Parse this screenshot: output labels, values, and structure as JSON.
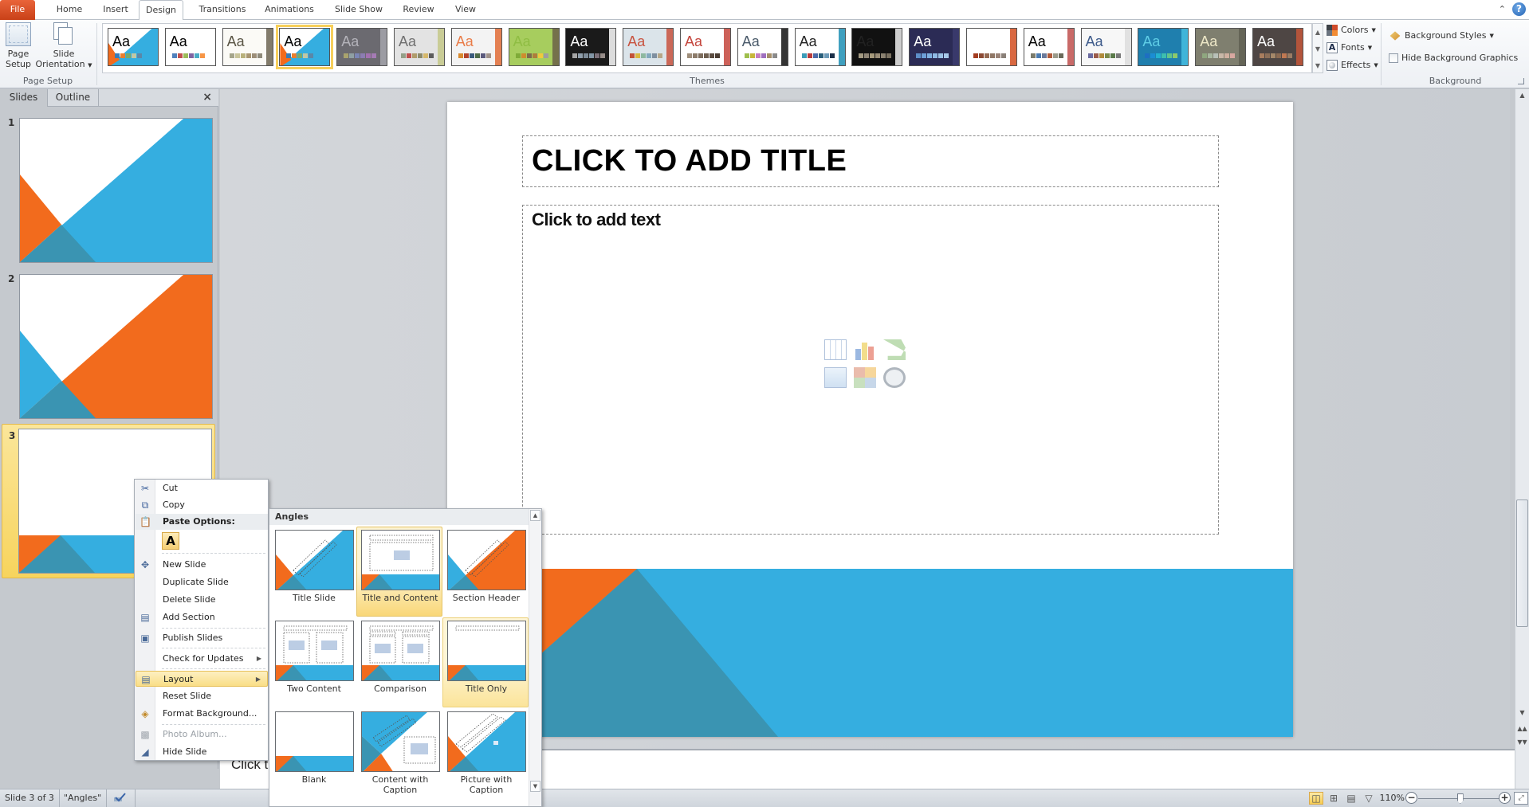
{
  "app": {
    "tabs": [
      {
        "label": "File"
      },
      {
        "label": "Home"
      },
      {
        "label": "Insert"
      },
      {
        "label": "Design"
      },
      {
        "label": "Transitions"
      },
      {
        "label": "Animations"
      },
      {
        "label": "Slide Show"
      },
      {
        "label": "Review"
      },
      {
        "label": "View"
      }
    ],
    "active_tab": "Design",
    "help_label": "?"
  },
  "ribbon": {
    "page_setup_group": {
      "label": "Page Setup",
      "page_setup_line1": "Page",
      "page_setup_line2": "Setup",
      "orientation_line1": "Slide",
      "orientation_line2": "Orientation"
    },
    "themes_group": {
      "label": "Themes",
      "selected_index": 3,
      "themes": [
        {
          "aa": "Aa",
          "bg": "#ffffff",
          "accent": "#35aee0",
          "text": "#000000",
          "swatches": [
            "#3b7bb5",
            "#e97e2e",
            "#7aa96d",
            "#c0c7a5",
            "#5a87a8"
          ]
        },
        {
          "aa": "Aa",
          "bg": "#ffffff",
          "accent": "#ffffff",
          "text": "#000000",
          "swatches": [
            "#4f81bd",
            "#c0504d",
            "#9bbb59",
            "#8064a2",
            "#4bacc6",
            "#f79646"
          ]
        },
        {
          "aa": "Aa",
          "bg": "#fbfaf6",
          "accent": "#6c6452",
          "text": "#5b5646",
          "swatches": [
            "#a5a58b",
            "#c9c59b",
            "#b8b07a",
            "#a89570",
            "#9c8e78",
            "#8f8a7b"
          ]
        },
        {
          "aa": "Aa",
          "bg": "#ffffff",
          "accent": "#35aee0",
          "text": "#000000",
          "swatches": [
            "#3b7bb5",
            "#e97e2e",
            "#7aa96d",
            "#c0c7a5",
            "#5a87a8"
          ]
        },
        {
          "aa": "Aa",
          "bg": "#6b6a70",
          "accent": "#a5a4ab",
          "text": "#b4b3ba",
          "swatches": [
            "#a9a36d",
            "#8fa0a3",
            "#7b86b5",
            "#8c7db2",
            "#a371b0",
            "#a57bb5"
          ]
        },
        {
          "aa": "Aa",
          "bg": "#e3e3e3",
          "accent": "#c4c888",
          "text": "#707070",
          "swatches": [
            "#94a088",
            "#c0504d",
            "#b09c6b",
            "#8c8a6a",
            "#d6b86b",
            "#5c5c5c"
          ]
        },
        {
          "aa": "Aa",
          "bg": "#f3f3f3",
          "accent": "#e06b35",
          "text": "#e97c48",
          "swatches": [
            "#d98a2e",
            "#b3432b",
            "#3a5a7c",
            "#4e6b48",
            "#5b5a7c",
            "#a0928a"
          ]
        },
        {
          "aa": "Aa",
          "bg": "#a7cd5e",
          "accent": "#6c6048",
          "text": "#8fbd43",
          "swatches": [
            "#7fab38",
            "#ce8d2d",
            "#7d6a4c",
            "#ae7d3b",
            "#f0c93d",
            "#9d9d9d"
          ]
        },
        {
          "aa": "Aa",
          "bg": "#1a1a1a",
          "accent": "#ffffff",
          "text": "#ffffff",
          "swatches": [
            "#a5a5a5",
            "#8f9eab",
            "#7d8b98",
            "#8296a6",
            "#7c7079",
            "#978d89"
          ]
        },
        {
          "aa": "Aa",
          "bg": "#dbe4ea",
          "accent": "#c8523e",
          "text": "#c8523e",
          "swatches": [
            "#c25238",
            "#d9b840",
            "#8db8a0",
            "#83a9be",
            "#7e8fa0",
            "#b6a789"
          ]
        },
        {
          "aa": "Aa",
          "bg": "#ffffff",
          "accent": "#c4453c",
          "text": "#c4453c",
          "swatches": [
            "#9f8e7b",
            "#8c7b6a",
            "#7d6d5d",
            "#6f5f50",
            "#5b4c40",
            "#4b3d33"
          ]
        },
        {
          "aa": "Aa",
          "bg": "#ffffff",
          "accent": "#111111",
          "text": "#4a5a6a",
          "swatches": [
            "#9fbf4d",
            "#c7b63a",
            "#c47fbf",
            "#9f6fbf",
            "#a68f6a",
            "#8a8a8a"
          ]
        },
        {
          "aa": "Aa",
          "bg": "#ffffff",
          "accent": "#1f8fb4",
          "text": "#222222",
          "swatches": [
            "#3b9cb8",
            "#b83b3b",
            "#4b6aa8",
            "#2a5f7b",
            "#6d9ab8",
            "#1b2f48"
          ]
        },
        {
          "aa": "Aa",
          "bg": "#111111",
          "accent": "#eeeeee",
          "text": "#222222",
          "swatches": [
            "#a39a82",
            "#8f8576",
            "#a69a7c",
            "#9a8d77",
            "#8b8271",
            "#7a7161"
          ]
        },
        {
          "aa": "Aa",
          "bg": "#2b2b55",
          "accent": "#3c3c70",
          "text": "#ffffff",
          "swatches": [
            "#5d8fc8",
            "#6ea0d8",
            "#7fb0e0",
            "#8fb9e3",
            "#9cc2e5",
            "#a8c8e8"
          ]
        },
        {
          "aa": "Aa",
          "bg": "#ffffff",
          "accent": "#d24d20",
          "text": "#ffffff",
          "swatches": [
            "#a43c20",
            "#8c4a33",
            "#946a53",
            "#8f7766",
            "#9a8377",
            "#8a8078"
          ]
        },
        {
          "aa": "Aa",
          "bg": "#ffffff",
          "accent": "#c0504d",
          "text": "#000000",
          "swatches": [
            "#7a7a6a",
            "#4a7ab0",
            "#6a7a9a",
            "#b05a3a",
            "#9a9a8a",
            "#6a6a5a"
          ]
        },
        {
          "aa": "Aa",
          "bg": "#f7f7f7",
          "accent": "#dddddd",
          "text": "#3d5a8a",
          "swatches": [
            "#6b6ba0",
            "#9a5a4a",
            "#b08a3a",
            "#7a8a4a",
            "#5a7a4a",
            "#7a7a7a"
          ]
        },
        {
          "aa": "Aa",
          "bg": "#1f7fae",
          "accent": "#46bde0",
          "text": "#5fcde6",
          "swatches": [
            "#1e6fc2",
            "#1a8dd4",
            "#24b2cf",
            "#3dbfae",
            "#62c48a",
            "#8cc96b"
          ]
        },
        {
          "aa": "Aa",
          "bg": "#7f7f6f",
          "accent": "#5f5f52",
          "text": "#eee8c8",
          "swatches": [
            "#8fa77f",
            "#a8b8a0",
            "#b8c0b8",
            "#c8b8a8",
            "#d0b0a0",
            "#d8a8a0"
          ]
        },
        {
          "aa": "Aa",
          "bg": "#4e4644",
          "accent": "#c6573a",
          "text": "#ffffff",
          "swatches": [
            "#a97d5e",
            "#8c6e58",
            "#a58869",
            "#8b6a52",
            "#c07852",
            "#9a7c64"
          ]
        }
      ]
    },
    "theme_options": {
      "colors_label": "Colors",
      "fonts_label": "Fonts",
      "effects_label": "Effects"
    },
    "background_group": {
      "label": "Background",
      "background_styles_label": "Background Styles",
      "hide_graphics_label": "Hide Background Graphics",
      "hide_graphics_checked": false
    }
  },
  "slides_panel": {
    "tabs": [
      {
        "label": "Slides"
      },
      {
        "label": "Outline"
      }
    ],
    "active_tab": "Slides",
    "close_label": "×",
    "slides": [
      {
        "number": "1",
        "layout": "Title Slide"
      },
      {
        "number": "2",
        "layout": "Section Header"
      },
      {
        "number": "3",
        "layout": "Title and Content",
        "selected": true
      }
    ]
  },
  "slide": {
    "title_placeholder": "CLICK TO ADD TITLE",
    "body_placeholder": "Click to add text",
    "insert_icons": [
      "insert-table-icon",
      "insert-chart-icon",
      "insert-smartart-icon",
      "insert-picture-icon",
      "insert-clipart-icon",
      "insert-media-icon"
    ],
    "colors": {
      "blue": "#35aee0",
      "orange": "#f26b1d",
      "teal_dark": "#3a94b2"
    }
  },
  "notes": {
    "placeholder": "Click to add notes"
  },
  "context_menu": {
    "items": [
      {
        "label": "Cut",
        "icon": "scissors-icon"
      },
      {
        "label": "Copy",
        "icon": "copy-icon"
      },
      {
        "label": "Paste Options:",
        "icon": "paste-icon",
        "header": true
      },
      {
        "label": "New Slide",
        "icon": "new-slide-icon"
      },
      {
        "label": "Duplicate Slide"
      },
      {
        "label": "Delete Slide"
      },
      {
        "label": "Add Section",
        "icon": "add-section-icon"
      },
      {
        "label": "Publish Slides",
        "icon": "publish-slides-icon"
      },
      {
        "label": "Check for Updates",
        "submenu": true
      },
      {
        "label": "Layout",
        "icon": "layout-icon",
        "submenu": true,
        "highlighted": true
      },
      {
        "label": "Reset Slide"
      },
      {
        "label": "Format Background...",
        "icon": "format-background-icon"
      },
      {
        "label": "Photo Album...",
        "icon": "photo-album-icon",
        "disabled": true
      },
      {
        "label": "Hide Slide",
        "icon": "hide-slide-icon"
      }
    ],
    "paste_option_label": "A"
  },
  "layout_submenu": {
    "header": "Angles",
    "layouts": [
      {
        "label": "Title Slide"
      },
      {
        "label": "Title and Content",
        "current": true
      },
      {
        "label": "Section Header"
      },
      {
        "label": "Two Content"
      },
      {
        "label": "Comparison"
      },
      {
        "label": "Title Only",
        "hover": true
      },
      {
        "label": "Blank"
      },
      {
        "label": "Content with Caption"
      },
      {
        "label": "Picture with Caption"
      }
    ]
  },
  "status_bar": {
    "slide_info": "Slide 3 of 3",
    "theme_name": "\"Angles\"",
    "zoom_level": "110%",
    "zoom_percent": 110,
    "views": [
      "normal-view",
      "slide-sorter-view",
      "reading-view",
      "slide-show-view"
    ],
    "active_view": "normal-view"
  }
}
